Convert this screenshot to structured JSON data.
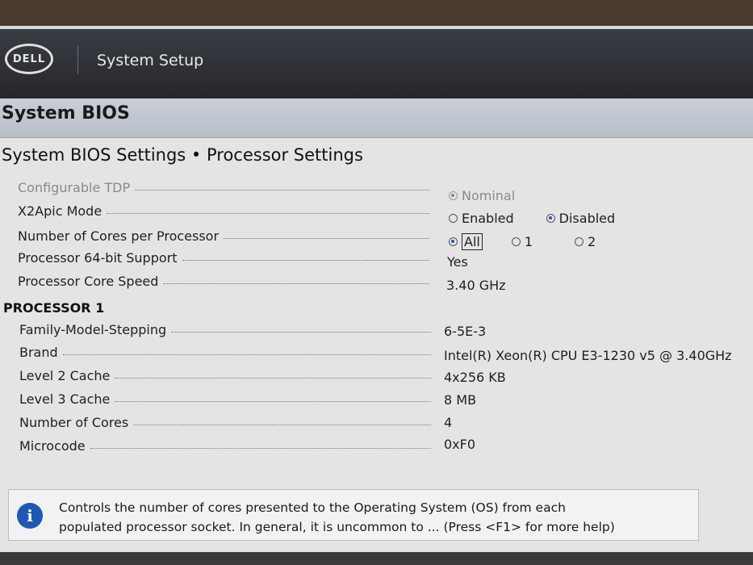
{
  "app": {
    "logo_text": "DELL",
    "title": "System Setup"
  },
  "section": {
    "title": "System BIOS"
  },
  "breadcrumb": "System BIOS Settings • Processor Settings",
  "settings": [
    {
      "label": "Configurable TDP",
      "dim": true
    },
    {
      "label": "X2Apic Mode"
    },
    {
      "label": "Number of Cores per Processor"
    },
    {
      "label": "Processor 64-bit Support",
      "value": "Yes"
    },
    {
      "label": "Processor Core Speed",
      "value": "3.40 GHz"
    }
  ],
  "options": {
    "tdp": {
      "nominal": "Nominal"
    },
    "x2apic": {
      "enabled": "Enabled",
      "disabled": "Disabled",
      "selected": "Disabled"
    },
    "cores": {
      "all": "All",
      "one": "1",
      "two": "2",
      "selected": "All"
    }
  },
  "processor1": {
    "header": "PROCESSOR 1",
    "rows": [
      {
        "label": "Family-Model-Stepping",
        "value": "6-5E-3"
      },
      {
        "label": "Brand",
        "value": "Intel(R) Xeon(R) CPU E3-1230 v5 @ 3.40GHz"
      },
      {
        "label": "Level 2 Cache",
        "value": "4x256 KB"
      },
      {
        "label": "Level 3 Cache",
        "value": "8 MB"
      },
      {
        "label": "Number of Cores",
        "value": "4"
      },
      {
        "label": "Microcode",
        "value": "0xF0"
      }
    ]
  },
  "help": {
    "line1": "Controls the number of cores presented to the Operating System (OS) from each",
    "line2": "populated processor socket. In general, it is uncommon to ... (Press <F1> for more help)"
  },
  "colors": {
    "accent": "#1a56c9",
    "header_bg": "#2b2d32",
    "section_bar": "#c1c6cf"
  }
}
